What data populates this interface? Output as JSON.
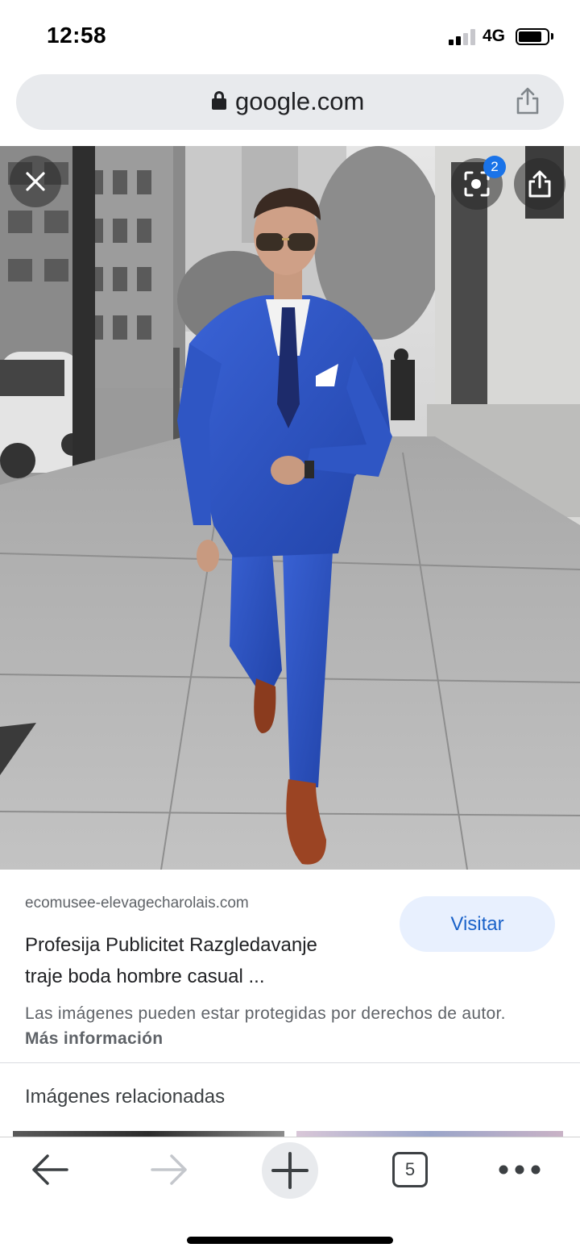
{
  "status_bar": {
    "time": "12:58",
    "network": "4G",
    "signal_bars_active": 2,
    "signal_bars_total": 4
  },
  "url_bar": {
    "domain": "google.com",
    "lock_icon": "lock-icon",
    "share_icon": "share-icon"
  },
  "image_viewer": {
    "close_icon": "close-icon",
    "lens_icon": "lens-icon",
    "lens_badge": "2",
    "share_icon": "share-icon"
  },
  "result": {
    "source": "ecomusee-elevagecharolais.com",
    "title_line1": "Profesija Publicitet Razgledavanje",
    "title_line2": "traje boda hombre casual ...",
    "visit_label": "Visitar",
    "copyright_text": "Las imágenes pueden estar protegidas por derechos de autor.",
    "more_info_label": "Más información"
  },
  "related": {
    "title": "Imágenes relacionadas"
  },
  "toolbar": {
    "tab_count": "5"
  },
  "colors": {
    "suit_blue": "#2d55c8",
    "accent_blue": "#1a73e8",
    "visit_bg": "#e8f0fe",
    "url_bar_bg": "#e8eaed"
  }
}
